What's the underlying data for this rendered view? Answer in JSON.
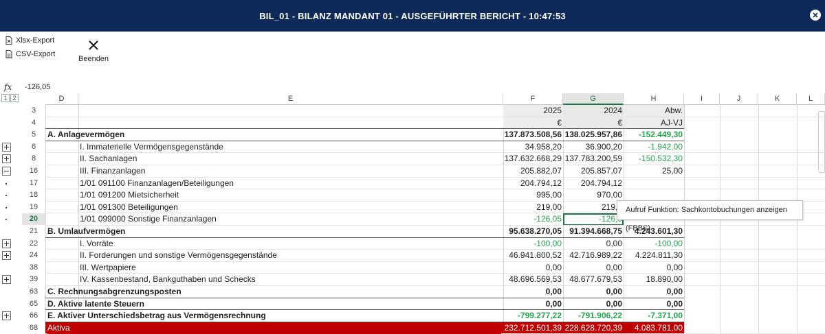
{
  "window": {
    "title": "BIL_01 - BILANZ MANDANT 01 - AUSGEFÜHRTER BERICHT - 10:47:53"
  },
  "toolbar": {
    "xlsx_label": "Xlsx-Export",
    "csv_label": "CSV-Export",
    "exit_label": "Beenden"
  },
  "formula_bar": {
    "fx_label": "fx",
    "value": "-126,05"
  },
  "outline_levels": [
    "1",
    "2"
  ],
  "columns": [
    "D",
    "E",
    "F",
    "G",
    "H",
    "I",
    "J",
    "K",
    "L"
  ],
  "rows": [
    {
      "n": "3",
      "d": "",
      "e": "",
      "f": "2025",
      "g": "2024",
      "h": "Abw."
    },
    {
      "n": "4",
      "d": "",
      "e": "",
      "f": "€",
      "g": "€",
      "h": "AJ-VJ"
    },
    {
      "n": "5",
      "d": "A. Anlagevermögen",
      "e": "",
      "f": "137.873.508,56",
      "g": "138.025.957,86",
      "h": "-152.449,30"
    },
    {
      "n": "6",
      "d": "",
      "e": "I. Immaterielle Vermögensgegenstände",
      "f": "34.958,20",
      "g": "36.900,20",
      "h": "-1.942,00"
    },
    {
      "n": "8",
      "d": "",
      "e": "II. Sachanlagen",
      "f": "137.632.668,29",
      "g": "137.783.200,59",
      "h": "-150.532,30"
    },
    {
      "n": "16",
      "d": "",
      "e": "III. Finanzanlagen",
      "f": "205.882,07",
      "g": "205.857,07",
      "h": "25,00"
    },
    {
      "n": "17",
      "d": "",
      "e": "1/01 091100  Finanzanlagen/Beteiligungen",
      "f": "204.794,12",
      "g": "204.794,12",
      "h": ""
    },
    {
      "n": "18",
      "d": "",
      "e": "1/01 091200  Mietsicherheit",
      "f": "995,00",
      "g": "970,00",
      "h": ""
    },
    {
      "n": "19",
      "d": "",
      "e": "1/01 091300  Beteiligungen",
      "f": "219,00",
      "g": "219,0",
      "h": ""
    },
    {
      "n": "20",
      "d": "",
      "e": "1/01 099000  Sonstige Finanzanlagen",
      "f": "-126,05",
      "g": "-126,0",
      "h": ""
    },
    {
      "n": "21",
      "d": "B. Umlaufvermögen",
      "e": "",
      "f": "95.638.270,05",
      "g": "91.394.668,75",
      "h": "4.243.601,30"
    },
    {
      "n": "22",
      "d": "",
      "e": "I. Vorräte",
      "f": "-100,00",
      "g": "0,00",
      "h": "-100,00"
    },
    {
      "n": "24",
      "d": "",
      "e": "II. Forderungen und sonstige Vermögensgegenstände",
      "f": "46.941.800,52",
      "g": "42.716.989,22",
      "h": "4.224.811,30"
    },
    {
      "n": "38",
      "d": "",
      "e": "III. Wertpapiere",
      "f": "0,00",
      "g": "0,00",
      "h": "0,00"
    },
    {
      "n": "39",
      "d": "",
      "e": "IV. Kassenbestand, Bankguthaben und Schecks",
      "f": "48.696.569,53",
      "g": "48.677.679,53",
      "h": "18.890,00"
    },
    {
      "n": "63",
      "d": "C. Rechnungsabgrenzungsposten",
      "e": "",
      "f": "0,00",
      "g": "0,00",
      "h": "0,00"
    },
    {
      "n": "65",
      "d": "D. Aktive latente Steuern",
      "e": "",
      "f": "0,00",
      "g": "0,00",
      "h": "0,00"
    },
    {
      "n": "66",
      "d": "E. Aktiver Unterschiedsbetrag aus Vermögensrechnung",
      "e": "",
      "f": "-799.277,22",
      "g": "-791.906,22",
      "h": "-7.371,00"
    },
    {
      "n": "68",
      "d": "Aktiva",
      "e": "",
      "f": "232.712.501,39",
      "g": "228.628.720,39",
      "h": "4.083.781,00"
    }
  ],
  "tooltip": "Aufruf Funktion: Sachkontobuchungen anzeigen (FBBS)",
  "colors": {
    "title_bg": "#0e2a59",
    "positive_green": "#22a64a",
    "total_red": "#c00000",
    "selection_green": "#217346"
  }
}
